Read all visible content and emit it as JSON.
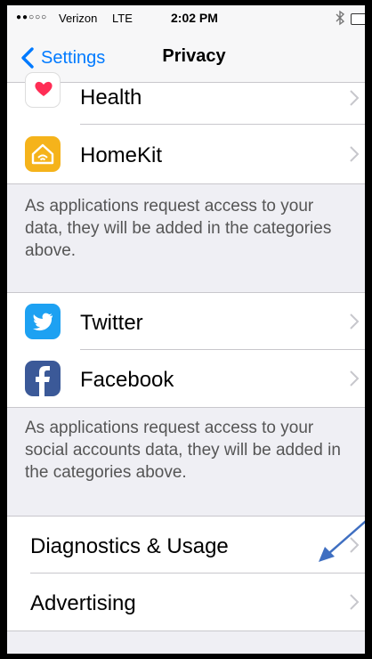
{
  "status_bar": {
    "signal": "●●○○○",
    "carrier": "Verizon",
    "network": "LTE",
    "time": "2:02 PM",
    "bluetooth_icon": "bluetooth-icon",
    "battery_icon": "battery-icon"
  },
  "nav": {
    "back_label": "Settings",
    "title": "Privacy"
  },
  "group1": {
    "items": [
      {
        "label": "Health",
        "icon": "health-heart-icon"
      },
      {
        "label": "HomeKit",
        "icon": "homekit-house-icon"
      }
    ],
    "footer": "As applications request access to your data, they will be added in the categories above."
  },
  "group2": {
    "items": [
      {
        "label": "Twitter",
        "icon": "twitter-bird-icon"
      },
      {
        "label": "Facebook",
        "icon": "facebook-f-icon"
      }
    ],
    "footer": "As applications request access to your social accounts data, they will be added in the categories above."
  },
  "group3": {
    "items": [
      {
        "label": "Diagnostics & Usage"
      },
      {
        "label": "Advertising"
      }
    ]
  },
  "colors": {
    "accent": "#007aff",
    "twitter": "#1da1f2",
    "facebook": "#3b5998",
    "homekit": "#f5b31b",
    "health_heart": "#ff2d55",
    "annotation_arrow": "#3f6fc1"
  }
}
